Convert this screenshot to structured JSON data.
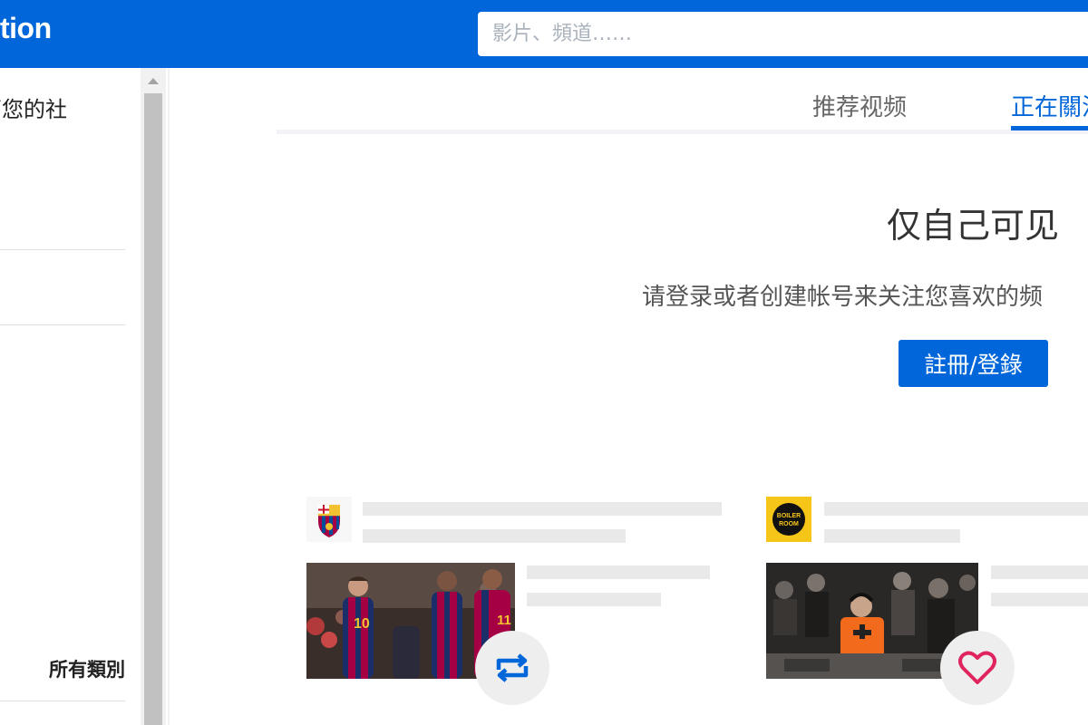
{
  "header": {
    "brand_text": "tion",
    "search_placeholder": "影片、頻道……"
  },
  "sidebar": {
    "intro_text": "管您的社",
    "category_label": "所有類別"
  },
  "tabs": [
    {
      "label": "推荐视频",
      "active": false
    },
    {
      "label": "正在關注",
      "active": true
    }
  ],
  "main": {
    "visibility_title": "仅自己可见",
    "visibility_desc": "请登录或者创建帐号来关注您喜欢的频",
    "login_button": "註冊/登錄"
  },
  "cards": [
    {
      "channel_icon": "fc-barcelona-logo",
      "thumbnail": "soccer-players-celebrating",
      "action_icon": "repost-icon"
    },
    {
      "channel_icon": "boiler-room-logo",
      "thumbnail": "dj-crowd-performance",
      "action_icon": "heart-icon"
    }
  ],
  "colors": {
    "brand_blue": "#0066d9",
    "heart_red": "#e0245e",
    "skeleton": "#e9e9e9"
  }
}
